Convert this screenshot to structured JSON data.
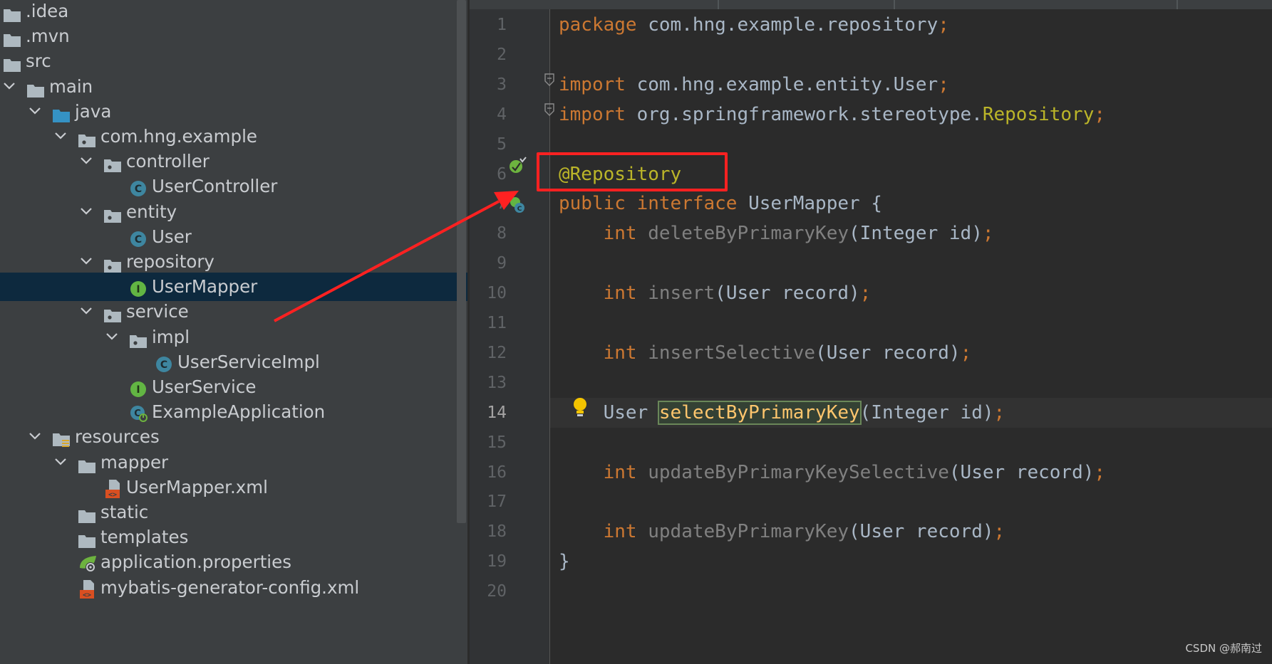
{
  "project_tree": {
    "items": [
      {
        "label": ".idea",
        "icon": "folder-icon",
        "expanded": null,
        "selected": false
      },
      {
        "label": ".mvn",
        "icon": "folder-icon",
        "expanded": null,
        "selected": false
      },
      {
        "label": "src",
        "icon": "folder-icon",
        "expanded": null,
        "selected": false
      },
      {
        "label": "main",
        "icon": "folder-icon",
        "expanded": true,
        "selected": false
      },
      {
        "label": "java",
        "icon": "source-folder-icon",
        "expanded": true,
        "selected": false
      },
      {
        "label": "com.hng.example",
        "icon": "package-icon",
        "expanded": true,
        "selected": false
      },
      {
        "label": "controller",
        "icon": "package-icon",
        "expanded": true,
        "selected": false
      },
      {
        "label": "UserController",
        "icon": "class-icon",
        "expanded": null,
        "selected": false
      },
      {
        "label": "entity",
        "icon": "package-icon",
        "expanded": true,
        "selected": false
      },
      {
        "label": "User",
        "icon": "class-icon",
        "expanded": null,
        "selected": false
      },
      {
        "label": "repository",
        "icon": "package-icon",
        "expanded": true,
        "selected": false
      },
      {
        "label": "UserMapper",
        "icon": "interface-icon",
        "expanded": null,
        "selected": true
      },
      {
        "label": "service",
        "icon": "package-icon",
        "expanded": true,
        "selected": false
      },
      {
        "label": "impl",
        "icon": "package-icon",
        "expanded": true,
        "selected": false
      },
      {
        "label": "UserServiceImpl",
        "icon": "class-icon",
        "expanded": null,
        "selected": false
      },
      {
        "label": "UserService",
        "icon": "interface-icon",
        "expanded": null,
        "selected": false
      },
      {
        "label": "ExampleApplication",
        "icon": "spring-boot-class-icon",
        "expanded": null,
        "selected": false
      },
      {
        "label": "resources",
        "icon": "resources-folder-icon",
        "expanded": true,
        "selected": false
      },
      {
        "label": "mapper",
        "icon": "folder-icon",
        "expanded": true,
        "selected": false
      },
      {
        "label": "UserMapper.xml",
        "icon": "xml-file-icon",
        "expanded": null,
        "selected": false
      },
      {
        "label": "static",
        "icon": "folder-icon",
        "expanded": null,
        "selected": false
      },
      {
        "label": "templates",
        "icon": "folder-icon",
        "expanded": null,
        "selected": false
      },
      {
        "label": "application.properties",
        "icon": "spring-properties-icon",
        "expanded": null,
        "selected": false
      },
      {
        "label": "mybatis-generator-config.xml",
        "icon": "xml-file-icon",
        "expanded": null,
        "selected": false
      }
    ]
  },
  "editor": {
    "active_line": 14,
    "lines": [
      {
        "n": 1,
        "tokens": [
          [
            "kw",
            "package"
          ],
          [
            "plain",
            " com.hng.example.repository"
          ],
          [
            "semi",
            ";"
          ]
        ]
      },
      {
        "n": 2,
        "tokens": []
      },
      {
        "n": 3,
        "tokens": [
          [
            "kw",
            "import"
          ],
          [
            "plain",
            " com.hng.example.entity.User"
          ],
          [
            "semi",
            ";"
          ]
        ]
      },
      {
        "n": 4,
        "tokens": [
          [
            "kw",
            "import"
          ],
          [
            "plain",
            " org.springframework.stereotype."
          ],
          [
            "ann",
            "Repository"
          ],
          [
            "semi",
            ";"
          ]
        ]
      },
      {
        "n": 5,
        "tokens": []
      },
      {
        "n": 6,
        "tokens": [
          [
            "ann",
            "@Repository"
          ]
        ]
      },
      {
        "n": 7,
        "tokens": [
          [
            "kw",
            "public"
          ],
          [
            "plain",
            " "
          ],
          [
            "kw",
            "interface"
          ],
          [
            "plain",
            " UserMapper {"
          ]
        ]
      },
      {
        "n": 8,
        "tokens": [
          [
            "plain",
            "    "
          ],
          [
            "kw",
            "int"
          ],
          [
            "plain",
            " "
          ],
          [
            "unused",
            "deleteByPrimaryKey"
          ],
          [
            "plain",
            "(Integer id)"
          ],
          [
            "semi",
            ";"
          ]
        ]
      },
      {
        "n": 9,
        "tokens": []
      },
      {
        "n": 10,
        "tokens": [
          [
            "plain",
            "    "
          ],
          [
            "kw",
            "int"
          ],
          [
            "plain",
            " "
          ],
          [
            "unused",
            "insert"
          ],
          [
            "plain",
            "(User record)"
          ],
          [
            "semi",
            ";"
          ]
        ]
      },
      {
        "n": 11,
        "tokens": []
      },
      {
        "n": 12,
        "tokens": [
          [
            "plain",
            "    "
          ],
          [
            "kw",
            "int"
          ],
          [
            "plain",
            " "
          ],
          [
            "unused",
            "insertSelective"
          ],
          [
            "plain",
            "(User record)"
          ],
          [
            "semi",
            ";"
          ]
        ]
      },
      {
        "n": 13,
        "tokens": []
      },
      {
        "n": 14,
        "tokens": [
          [
            "plain",
            "    User "
          ],
          [
            "hl",
            "selectByPrimaryKey"
          ],
          [
            "plain",
            "(Integer id)"
          ],
          [
            "semi",
            ";"
          ]
        ]
      },
      {
        "n": 15,
        "tokens": []
      },
      {
        "n": 16,
        "tokens": [
          [
            "plain",
            "    "
          ],
          [
            "kw",
            "int"
          ],
          [
            "plain",
            " "
          ],
          [
            "unused",
            "updateByPrimaryKeySelective"
          ],
          [
            "plain",
            "(User record)"
          ],
          [
            "semi",
            ";"
          ]
        ]
      },
      {
        "n": 17,
        "tokens": []
      },
      {
        "n": 18,
        "tokens": [
          [
            "plain",
            "    "
          ],
          [
            "kw",
            "int"
          ],
          [
            "plain",
            " "
          ],
          [
            "unused",
            "updateByPrimaryKey"
          ],
          [
            "plain",
            "(User record)"
          ],
          [
            "semi",
            ";"
          ]
        ]
      },
      {
        "n": 19,
        "tokens": [
          [
            "plain",
            "}"
          ]
        ]
      },
      {
        "n": 20,
        "tokens": []
      }
    ]
  },
  "gutter_icons": [
    {
      "line": 3,
      "icon": "fold-icon"
    },
    {
      "line": 4,
      "icon": "fold-icon"
    },
    {
      "line": 6,
      "icon": "spring-bean-icon"
    },
    {
      "line": 7,
      "icon": "implemented-icon"
    },
    {
      "line": 14,
      "icon": "lightbulb-icon"
    }
  ],
  "colors": {
    "keyword": "#cc7832",
    "annotation": "#bbb529",
    "plain": "#a9b7c6",
    "unused": "#808080",
    "selection": "#0d293e",
    "red_annotation": "#ff2121"
  },
  "watermark": "CSDN @郝南过"
}
